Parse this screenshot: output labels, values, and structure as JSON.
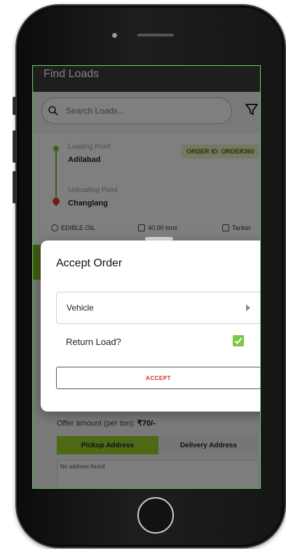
{
  "appbar": {
    "title": "Find Loads"
  },
  "search": {
    "placeholder": "Search Loads..."
  },
  "card": {
    "loading_label": "Loading Point",
    "loading_value": "Adilabad",
    "unloading_label": "Unloading Point",
    "unloading_value": "Changlang",
    "order_id": "ORDER ID: ORDER360",
    "material": "EDIBLE OIL",
    "weight": "40.00 tons",
    "truck_type": "Tanker"
  },
  "offer": {
    "label": "Offer amount (per ton):",
    "value": "₹70/-"
  },
  "address_tabs": {
    "pickup": "Pickup Address",
    "delivery": "Delivery Address",
    "empty": "No address found"
  },
  "modal": {
    "title": "Accept Order",
    "vehicle_label": "Vehicle",
    "return_label": "Return Load?",
    "return_checked": true,
    "accept_label": "ACCEPT"
  },
  "colors": {
    "accent": "#84b820",
    "check": "#7ac943",
    "accept_text": "#d0312d"
  }
}
